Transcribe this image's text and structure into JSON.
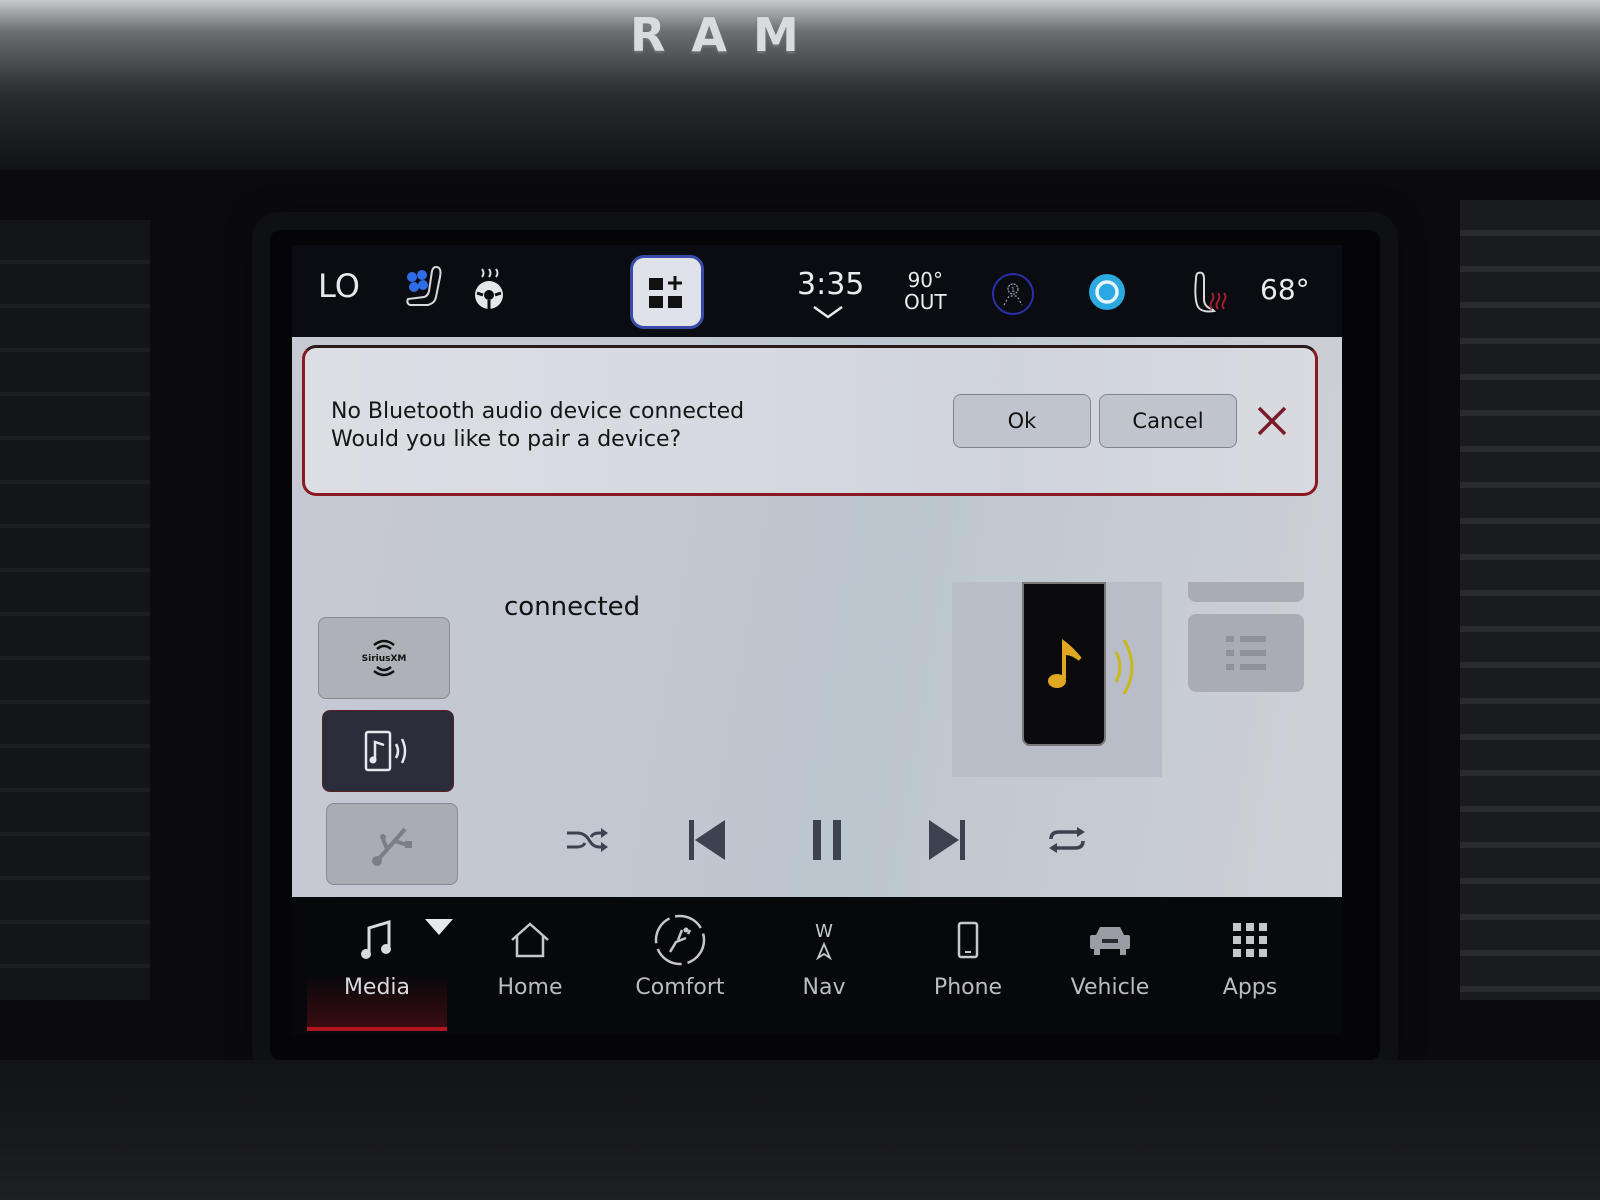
{
  "dashboard": {
    "brand_logo": "RAM"
  },
  "status_bar": {
    "fan_level": "LO",
    "clock": "3:35",
    "outside_temp": "90°",
    "outside_label": "OUT",
    "set_temp": "68°",
    "icons": [
      "seat-ventilation-icon",
      "heated-steering-wheel-icon",
      "add-widget-icon",
      "driver-profile-icon",
      "alexa-icon",
      "heated-seat-icon"
    ]
  },
  "popup": {
    "line1": "No Bluetooth audio device connected",
    "line2": "Would you like to pair a device?",
    "ok_label": "Ok",
    "cancel_label": "Cancel",
    "border_color": "#8a1a22"
  },
  "media": {
    "sources": [
      {
        "id": "sxm",
        "label": "SiriusXM",
        "active": false
      },
      {
        "id": "bluetooth",
        "label": "Bluetooth Audio",
        "active": true
      },
      {
        "id": "usb",
        "label": "USB",
        "active": false
      }
    ],
    "status_text": "connected",
    "controls": [
      "shuffle",
      "previous",
      "pause",
      "next",
      "repeat"
    ]
  },
  "bottom_nav": {
    "items": [
      {
        "label": "Media",
        "active": true
      },
      {
        "label": "Home"
      },
      {
        "label": "Comfort"
      },
      {
        "label": "Nav",
        "compass": "W"
      },
      {
        "label": "Phone"
      },
      {
        "label": "Vehicle"
      },
      {
        "label": "Apps"
      }
    ]
  },
  "colors": {
    "accent_red": "#b01520",
    "alexa_blue": "#2aa8e0",
    "seat_fan_blue": "#2f6de8",
    "art_gold": "#e0a820"
  }
}
